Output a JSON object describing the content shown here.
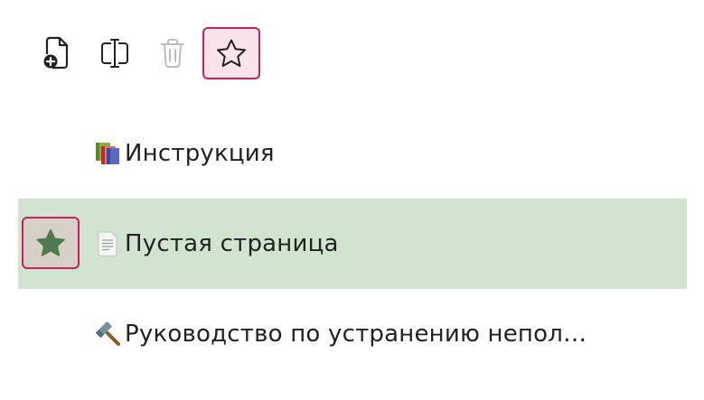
{
  "toolbar": {
    "buttons": [
      {
        "name": "new-page-button",
        "icon": "file-plus-icon"
      },
      {
        "name": "rename-button",
        "icon": "text-cursor-icon"
      },
      {
        "name": "delete-button",
        "icon": "trash-icon",
        "disabled": true
      },
      {
        "name": "favorite-button",
        "icon": "star-outline-icon",
        "active": true
      }
    ]
  },
  "pages": [
    {
      "icon": "books-emoji-icon",
      "title": "Инструкция",
      "selected": false,
      "favorited": false
    },
    {
      "icon": "page-emoji-icon",
      "title": "Пустая страница",
      "selected": true,
      "favorited": true
    },
    {
      "icon": "hammer-emoji-icon",
      "title": "Руководство по устранению непол…",
      "selected": false,
      "favorited": false
    }
  ],
  "colors": {
    "accent": "#d01d5f",
    "selected_row": "#d0e4d0",
    "favorite_star": "#4f7a4c",
    "active_button_bg": "#fbe3ec"
  }
}
